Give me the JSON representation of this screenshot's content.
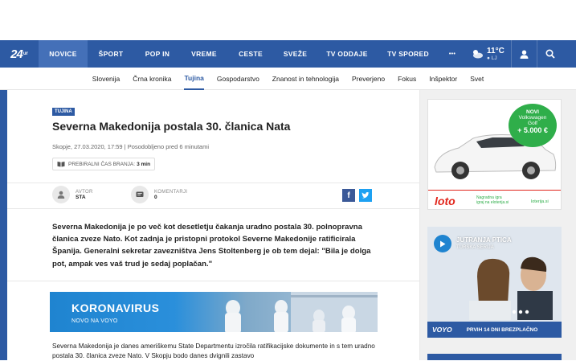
{
  "nav": {
    "logo": "24",
    "logo_sub": "ur",
    "items": [
      "NOVICE",
      "ŠPORT",
      "POP IN",
      "VREME",
      "CESTE",
      "SVEŽE",
      "TV ODDAJE",
      "TV SPORED",
      "•••"
    ],
    "weather_temp": "11°C",
    "weather_loc": "● LJ"
  },
  "subnav": {
    "items": [
      "Slovenija",
      "Črna kronika",
      "Tujina",
      "Gospodarstvo",
      "Znanost in tehnologija",
      "Preverjeno",
      "Fokus",
      "Inšpektor",
      "Svet"
    ],
    "active": "Tujina"
  },
  "article": {
    "badge": "TUJINA",
    "title": "Severna Makedonija postala 30. članica Nata",
    "meta": "Skopje, 27.03.2020, 17:59 | Posodobljeno pred 6 minutami",
    "readtime_label": "PREBIRALNI ČAS BRANJA:",
    "readtime_value": "3 min",
    "author_label": "AVTOR",
    "author_value": "STA",
    "comments_label": "KOMENTARJI",
    "comments_value": "0",
    "lead": "Severna Makedonija je po več kot desetletju čakanja uradno postala 30. polnopravna članica zveze Nato. Kot zadnja je pristopni protokol Severne Makedonije ratificirala Španija. Generalni sekretar zavezništva Jens Stoltenberg je ob tem dejal: \"Bila je dolga pot, ampak ves vaš trud je sedaj poplačan.\"",
    "banner_title": "KORONAVIRUS",
    "banner_sub": "NOVO NA VOYO",
    "body": "Severna Makedonija je danes ameriškemu State Departmentu izročila ratifikacijske dokumente in s tem uradno postala 30. članica zveze Nato. V Skopju bodo danes dvignili zastavo"
  },
  "ads": {
    "ad1_badge_line1": "NOVI",
    "ad1_badge_line2": "Volkswagen",
    "ad1_badge_line3": "Golf",
    "ad1_badge_price": "+ 5.000 €",
    "ad1_brand": "loto",
    "ad1_note1": "Nagradna igra",
    "ad1_note2": "igraj na eloterija.si",
    "ad1_site": "loterija.si",
    "ad2_title": "JUTRANJA PTICA",
    "ad2_sub": "TURŠKA SERIJA",
    "ad2_brand": "VOYO",
    "ad2_cta": "PRVIH 14 DNI BREZPLAČNO"
  },
  "colors": {
    "brand": "#2d5aa3",
    "ad_red": "#e1251b"
  }
}
